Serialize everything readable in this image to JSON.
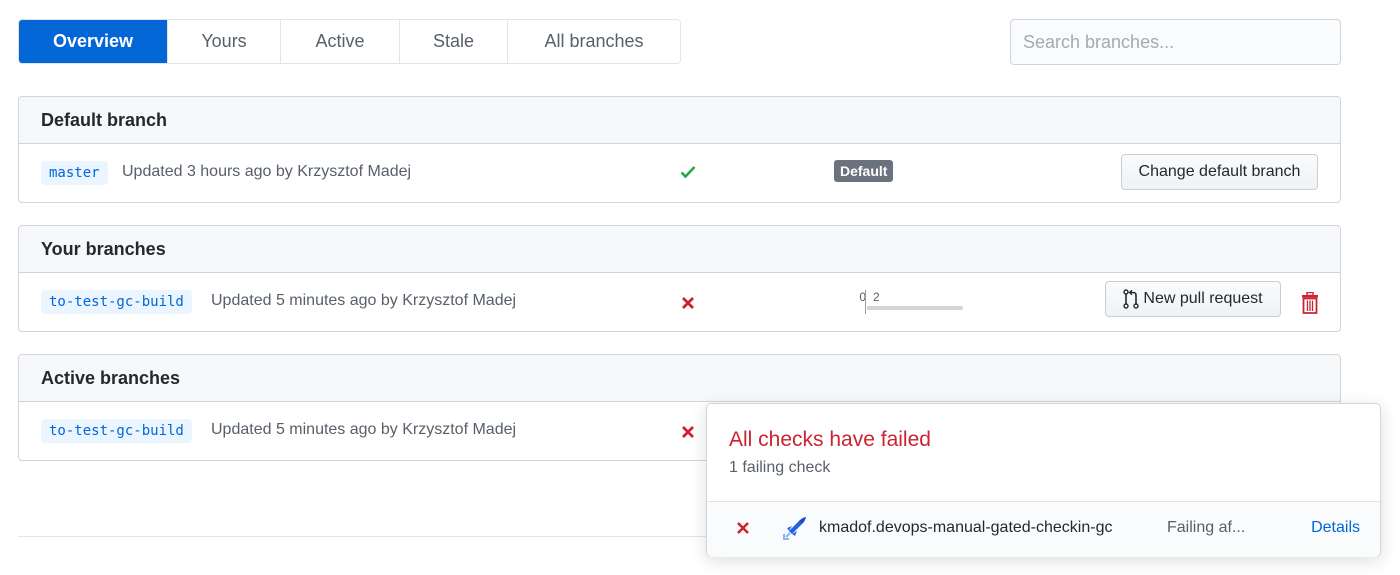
{
  "tabs": [
    {
      "label": "Overview",
      "selected": true
    },
    {
      "label": "Yours",
      "selected": false
    },
    {
      "label": "Active",
      "selected": false
    },
    {
      "label": "Stale",
      "selected": false
    },
    {
      "label": "All branches",
      "selected": false
    }
  ],
  "search": {
    "placeholder": "Search branches...",
    "value": ""
  },
  "sections": {
    "default": {
      "title": "Default branch",
      "branch": "master",
      "updated": "Updated 3 hours ago by Krzysztof Madej",
      "status": "success",
      "badge": "Default",
      "action_label": "Change default branch"
    },
    "yours": {
      "title": "Your branches",
      "branch": "to-test-gc-build",
      "updated": "Updated 5 minutes ago by Krzysztof Madej",
      "status": "failure",
      "behind": "0",
      "ahead": "2",
      "action_label": "New pull request"
    },
    "active": {
      "title": "Active branches",
      "branch": "to-test-gc-build",
      "updated": "Updated 5 minutes ago by Krzysztof Madej",
      "status": "failure"
    }
  },
  "popover": {
    "title": "All checks have failed",
    "subtitle": "1 failing check",
    "checks": [
      {
        "status": "failure",
        "name": "kmadof.devops-manual-gated-checkin-gc",
        "description": "Failing af...",
        "link_label": "Details"
      }
    ]
  },
  "colors": {
    "accent": "#0366d6",
    "success": "#28a745",
    "failure": "#cb2431",
    "badge": "#6a737d"
  }
}
